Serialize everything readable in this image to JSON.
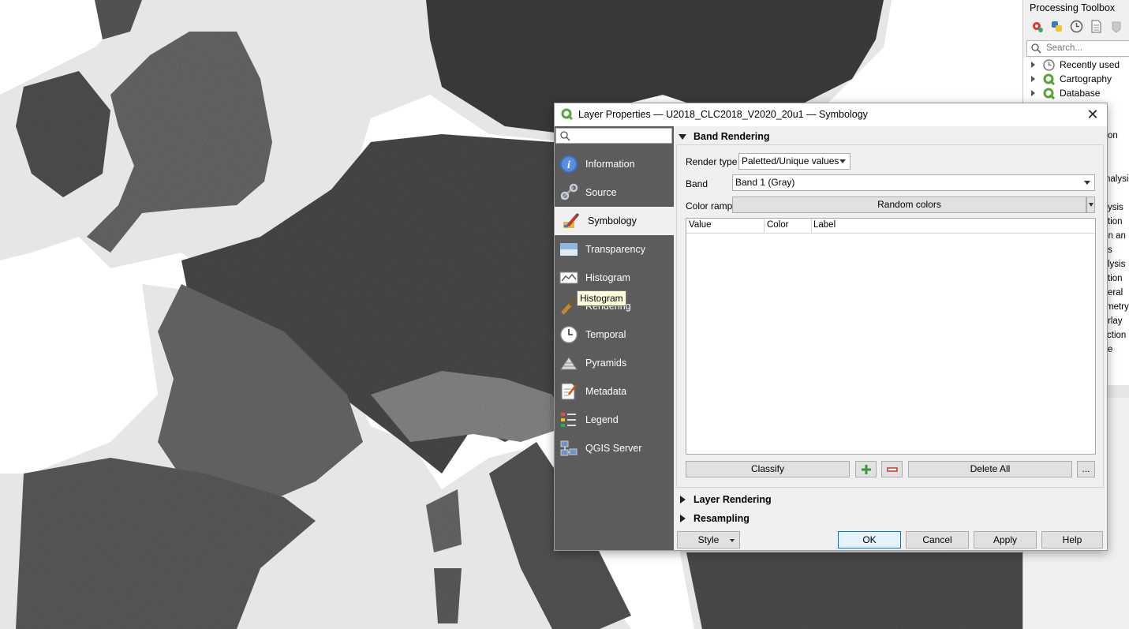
{
  "toolbox": {
    "title": "Processing Toolbox",
    "search_placeholder": "Search...",
    "tree": [
      {
        "label": "Recently used",
        "icon": "clock-icon"
      },
      {
        "label": "Cartography",
        "icon": "qgis-icon"
      },
      {
        "label": "Database",
        "icon": "qgis-icon"
      }
    ],
    "partial_items": [
      "on",
      "nalysis",
      "ysis",
      "tion",
      "in an",
      "s",
      "lysis",
      "tion",
      "eral",
      "metry",
      "rlay",
      "ction",
      "e"
    ]
  },
  "dialog": {
    "title": "Layer Properties — U2018_CLC2018_V2020_20u1 — Symbology",
    "nav": [
      {
        "label": "Information",
        "icon": "information-icon"
      },
      {
        "label": "Source",
        "icon": "source-icon"
      },
      {
        "label": "Symbology",
        "icon": "symbology-icon"
      },
      {
        "label": "Transparency",
        "icon": "transparency-icon"
      },
      {
        "label": "Histogram",
        "icon": "histogram-icon"
      },
      {
        "label": "Rendering",
        "icon": "rendering-icon"
      },
      {
        "label": "Temporal",
        "icon": "temporal-icon"
      },
      {
        "label": "Pyramids",
        "icon": "pyramids-icon"
      },
      {
        "label": "Metadata",
        "icon": "metadata-icon"
      },
      {
        "label": "Legend",
        "icon": "legend-icon"
      },
      {
        "label": "QGIS Server",
        "icon": "qgis-server-icon"
      }
    ],
    "tooltip": "Histogram",
    "band_rendering": {
      "title": "Band Rendering",
      "render_type_label": "Render type",
      "render_type_value": "Paletted/Unique values",
      "band_label": "Band",
      "band_value": "Band 1 (Gray)",
      "color_ramp_label": "Color ramp",
      "color_ramp_value": "Random colors",
      "columns": [
        "Value",
        "Color",
        "Label"
      ],
      "classify_label": "Classify",
      "delete_all_label": "Delete All",
      "more_label": "..."
    },
    "layer_rendering_title": "Layer Rendering",
    "resampling_title": "Resampling",
    "footer": {
      "style": "Style",
      "ok": "OK",
      "cancel": "Cancel",
      "apply": "Apply",
      "help": "Help"
    }
  }
}
